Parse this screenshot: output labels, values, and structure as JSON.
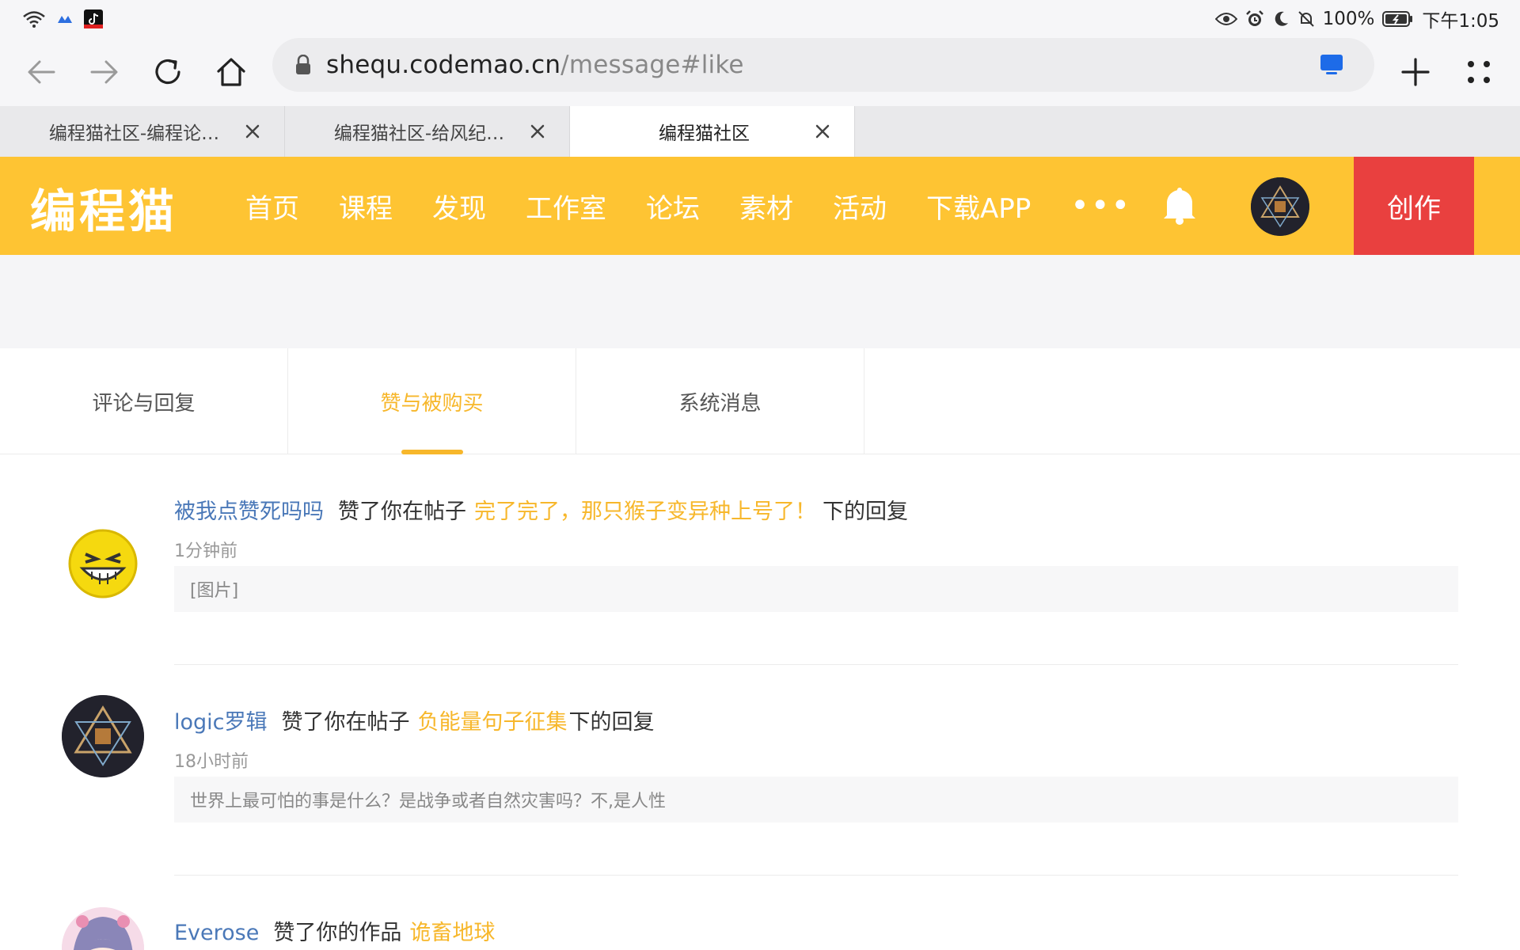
{
  "statusbar": {
    "battery": "100%",
    "time": "下午1:05"
  },
  "browser": {
    "url_host": "shequ.codemao.cn",
    "url_path": "/message#like",
    "tabs": [
      {
        "title": "编程猫社区-编程论…"
      },
      {
        "title": "编程猫社区-给风纪…"
      },
      {
        "title": "编程猫社区"
      }
    ]
  },
  "site": {
    "logo": "编程猫",
    "nav": [
      "首页",
      "课程",
      "发现",
      "工作室",
      "论坛",
      "素材",
      "活动",
      "下载APP"
    ],
    "more": "•••",
    "create": "创作"
  },
  "subtabs": [
    "评论与回复",
    "赞与被购买",
    "系统消息"
  ],
  "messages": [
    {
      "user": "被我点赞死吗吗",
      "verb": "赞了你在帖子",
      "target": "完了完了，那只猴子变异种上号了！",
      "suffix": "下的回复",
      "time": "1分钟前",
      "quote": "[图片]"
    },
    {
      "user": "logic罗辑",
      "verb": "赞了你在帖子",
      "target": "负能量句子征集",
      "suffix": "下的回复",
      "time": "18小时前",
      "quote": "世界上最可怕的事是什么？是战争或者自然灾害吗？不,是人性"
    },
    {
      "user": "Everose",
      "verb": "赞了你的作品",
      "target": "诡畜地球",
      "suffix": "",
      "time": "",
      "quote": ""
    }
  ],
  "colors": {
    "brand_yellow": "#fec433",
    "create_red": "#e9403f",
    "link_blue": "#4a78b8",
    "accent_yellow": "#f7b72b"
  }
}
